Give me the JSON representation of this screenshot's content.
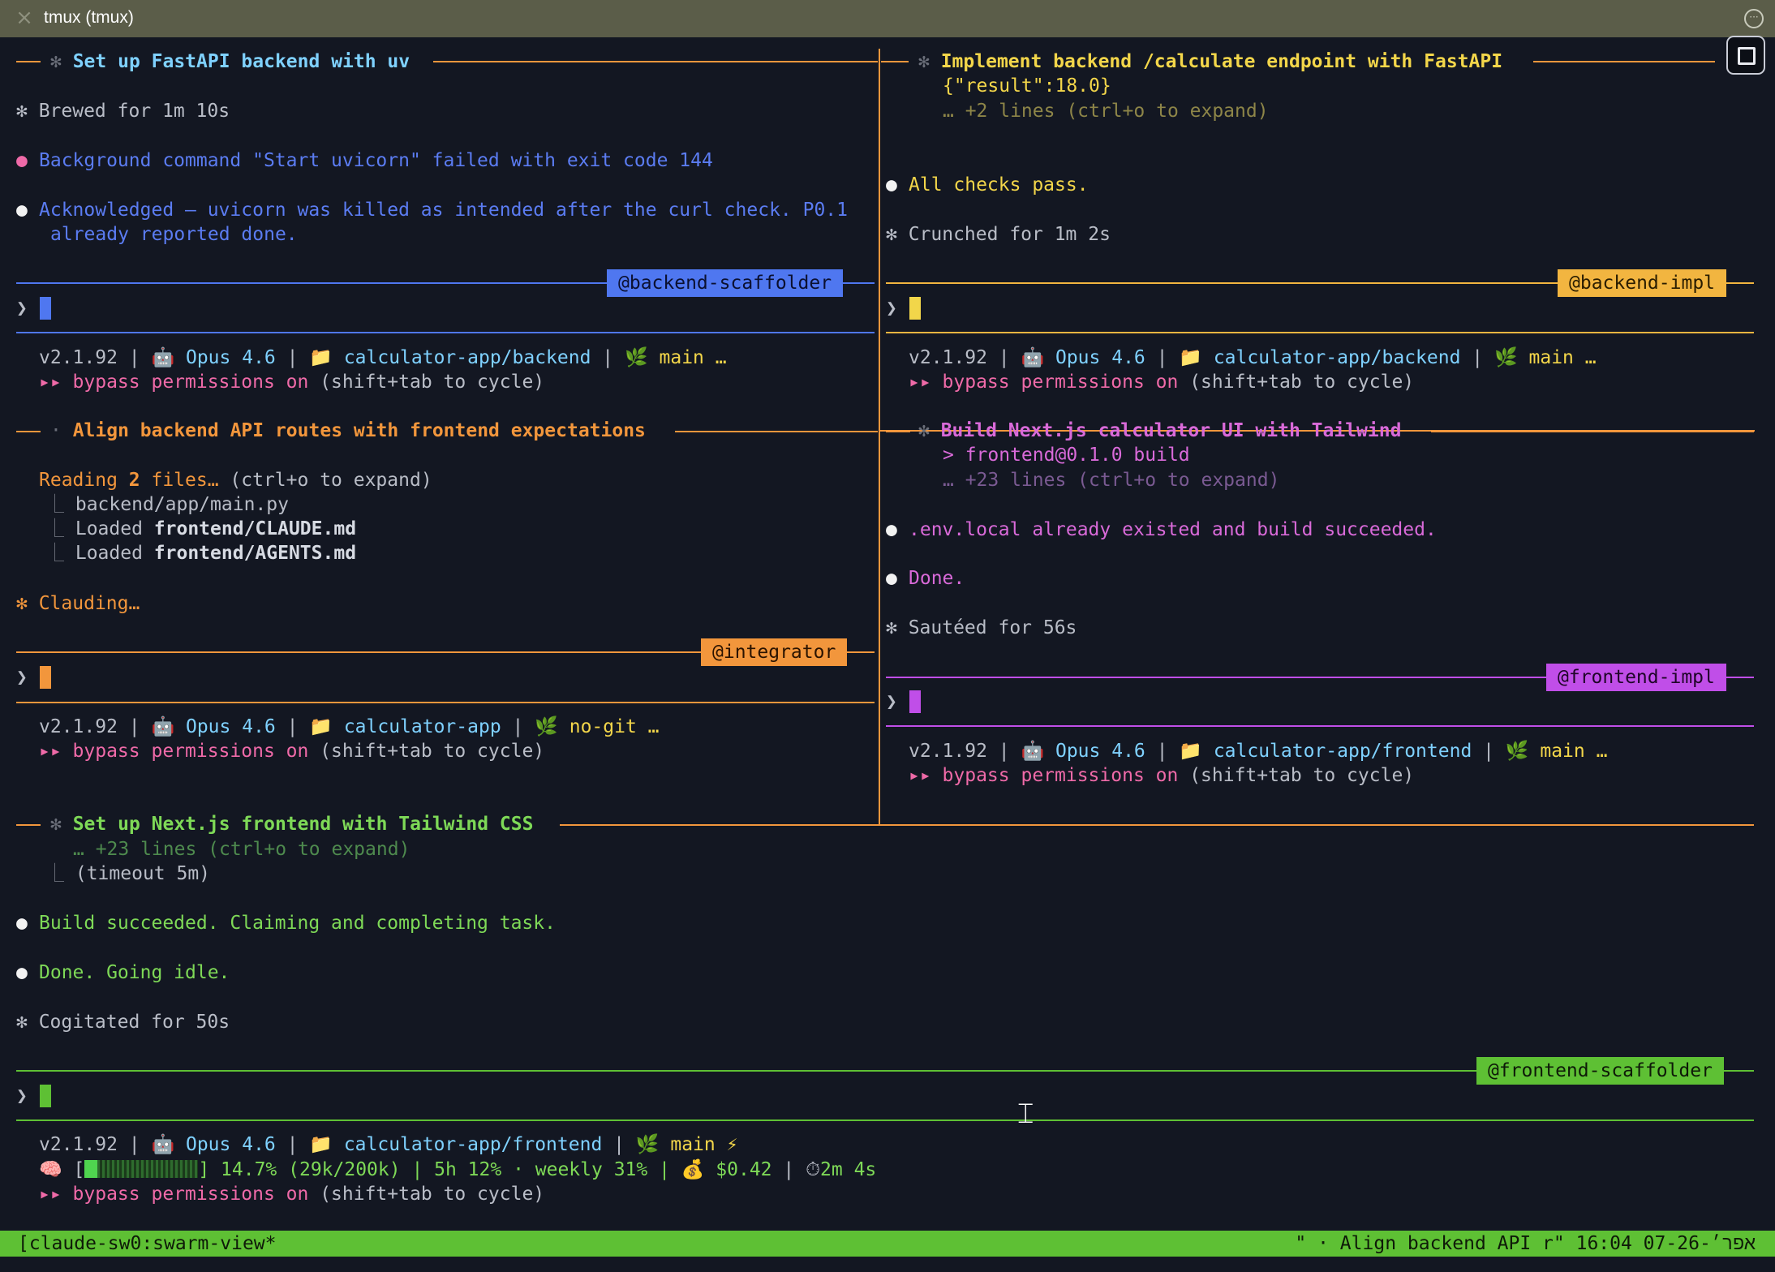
{
  "window": {
    "title": "tmux (tmux)"
  },
  "colors": {
    "backend_scaffolder": "#4f77f0",
    "backend_impl": "#f2b540",
    "integrator": "#f2963c",
    "frontend_impl": "#c04ee8",
    "frontend_scaffolder": "#5ec034",
    "background": "#131722"
  },
  "panes": {
    "backend_scaffolder": {
      "task": "Set up FastAPI backend with uv",
      "lines": [
        "✻ Brewed for 1m 10s",
        "Background command \"Start uvicorn\" failed with exit code 144",
        "Acknowledged — uvicorn was killed as intended after the curl check. P0.1",
        "already reported done."
      ],
      "tag": "@backend-scaffolder",
      "status": {
        "version": "v2.1.92",
        "model": "Opus 4.6",
        "dir": "calculator-app/backend",
        "branch": "main …",
        "perm_a": "▸▸ bypass permissions on",
        "perm_b": " (shift+tab to cycle)"
      }
    },
    "backend_impl": {
      "task": "Implement backend /calculate endpoint with FastAPI",
      "lines": [
        "{\"result\":18.0}",
        "… +2 lines (ctrl+o to expand)",
        "All checks pass.",
        "✻ Crunched for 1m 2s"
      ],
      "tag": "@backend-impl",
      "status": {
        "version": "v2.1.92",
        "model": "Opus 4.6",
        "dir": "calculator-app/backend",
        "branch": "main …",
        "perm_a": "▸▸ bypass permissions on",
        "perm_b": " (shift+tab to cycle)"
      }
    },
    "integrator": {
      "task": "Align backend API routes with frontend expectations",
      "reading_a": "Reading ",
      "reading_b": "2",
      "reading_c": " files… ",
      "reading_d": "(ctrl+o to expand)",
      "file1": "backend/app/main.py",
      "loaded": "Loaded ",
      "file2": "frontend/CLAUDE.md",
      "file3": "frontend/AGENTS.md",
      "thinking": "Clauding…",
      "tag": "@integrator",
      "status": {
        "version": "v2.1.92",
        "model": "Opus 4.6",
        "dir": "calculator-app",
        "branch": "no-git …",
        "perm_a": "▸▸ bypass permissions on",
        "perm_b": " (shift+tab to cycle)"
      }
    },
    "frontend_impl": {
      "task": "Build Next.js calculator UI with Tailwind",
      "lines": [
        "> frontend@0.1.0 build",
        "… +23 lines (ctrl+o to expand)",
        ".env.local already existed and build succeeded.",
        "Done.",
        "✻ Sautéed for 56s"
      ],
      "tag": "@frontend-impl",
      "status": {
        "version": "v2.1.92",
        "model": "Opus 4.6",
        "dir": "calculator-app/frontend",
        "branch": "main …",
        "perm_a": "▸▸ bypass permissions on",
        "perm_b": " (shift+tab to cycle)"
      }
    },
    "frontend_scaffolder": {
      "task": "Set up Next.js frontend with Tailwind CSS",
      "lines": [
        "… +23 lines (ctrl+o to expand)",
        "(timeout 5m)",
        "Build succeeded. Claiming and completing task.",
        "Done. Going idle.",
        "✻ Cogitated for 50s"
      ],
      "tag": "@frontend-scaffolder",
      "status": {
        "version": "v2.1.92",
        "model": "Opus 4.6",
        "dir": "calculator-app/frontend",
        "branch": "main ⚡",
        "context": "] 14.7% (29k/200k) | 5h 12% · weekly 31% | ",
        "cost": "$0.42",
        "elapsed": "2m 4s",
        "perm_a": "▸▸ bypass permissions on",
        "perm_b": " (shift+tab to cycle)"
      }
    }
  },
  "statusbar": {
    "left": "[claude-sw0:swarm-view*",
    "right": "\" · Align backend API r\" 16:04 07-אפר׳-26"
  },
  "glyphs": {
    "prompt": "❯",
    "bullet": "●",
    "sep": " | ",
    "robot": "🤖 ",
    "folder": "📁 ",
    "leaf": "🌿 ",
    "brain": "🧠 [",
    "money": "💰 ",
    "timer": "⏱",
    "tree": "⎿ "
  }
}
